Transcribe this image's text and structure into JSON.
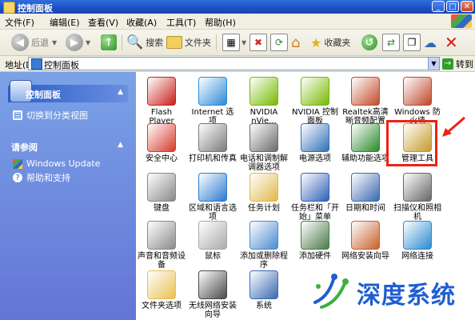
{
  "window": {
    "title": "控制面板"
  },
  "menu": [
    "文件(F)",
    "编辑(E)",
    "查看(V)",
    "收藏(A)",
    "工具(T)",
    "帮助(H)"
  ],
  "toolbar": {
    "back_label": "后退",
    "search_label": "搜索",
    "folders_label": "文件夹",
    "favorites_label": "收藏夹"
  },
  "address": {
    "label": "地址(D)",
    "value": "控制面板",
    "go_label": "转到"
  },
  "sidebar": {
    "panel1": {
      "title": "控制面板",
      "items": [
        {
          "label": "切换到分类视图",
          "icon": "category-view-icon"
        }
      ]
    },
    "panel2": {
      "title": "请参阅",
      "items": [
        {
          "label": "Windows Update",
          "icon": "windows-update-icon"
        },
        {
          "label": "帮助和支持",
          "icon": "help-icon"
        }
      ]
    }
  },
  "control_panel_items": [
    {
      "label": "Flash Player",
      "icon": "flash-icon",
      "color": "#c8201a"
    },
    {
      "label": "Internet 选项",
      "icon": "globe-icon",
      "color": "#2a8ad8"
    },
    {
      "label": "NVIDIA nVie...",
      "icon": "nvidia-icon",
      "color": "#76b900"
    },
    {
      "label": "NVIDIA 控制面板",
      "icon": "nvidia-panel-icon",
      "color": "#76b900"
    },
    {
      "label": "Realtek高清晰音频配置",
      "icon": "speaker-icon",
      "color": "#c24b2a"
    },
    {
      "label": "Windows 防火墙",
      "icon": "firewall-icon",
      "color": "#c0462a"
    },
    {
      "label": "安全中心",
      "icon": "shield-icon",
      "color": "#d43a2a"
    },
    {
      "label": "打印机和传真",
      "icon": "printer-icon",
      "color": "#7a7a7a"
    },
    {
      "label": "电话和调制解调器选项",
      "icon": "phone-icon",
      "color": "#6a6a6a"
    },
    {
      "label": "电源选项",
      "icon": "power-icon",
      "color": "#2f6fb8"
    },
    {
      "label": "辅助功能选项",
      "icon": "accessibility-icon",
      "color": "#2a8a2a"
    },
    {
      "label": "管理工具",
      "icon": "admin-tools-icon",
      "color": "#c49a2a"
    },
    {
      "label": "键盘",
      "icon": "keyboard-icon",
      "color": "#888888"
    },
    {
      "label": "区域和语言选项",
      "icon": "region-globe-icon",
      "color": "#2a7ad0"
    },
    {
      "label": "任务计划",
      "icon": "task-folder-icon",
      "color": "#e0b84a"
    },
    {
      "label": "任务栏和「开始」菜单",
      "icon": "taskbar-icon",
      "color": "#2f5fb8"
    },
    {
      "label": "日期和时间",
      "icon": "clock-icon",
      "color": "#3a6ab0"
    },
    {
      "label": "扫描仪和照相机",
      "icon": "scanner-icon",
      "color": "#666666"
    },
    {
      "label": "声音和音频设备",
      "icon": "sound-icon",
      "color": "#8a8a8a"
    },
    {
      "label": "鼠标",
      "icon": "mouse-icon",
      "color": "#aaaaaa"
    },
    {
      "label": "添加或删除程序",
      "icon": "add-remove-icon",
      "color": "#4a8ad0"
    },
    {
      "label": "添加硬件",
      "icon": "hardware-icon",
      "color": "#4a7a4a"
    },
    {
      "label": "网络安装向导",
      "icon": "network-setup-icon",
      "color": "#c8602a"
    },
    {
      "label": "网络连接",
      "icon": "network-icon",
      "color": "#2a8ad0"
    },
    {
      "label": "文件夹选项",
      "icon": "folder-options-icon",
      "color": "#e8c050"
    },
    {
      "label": "无线网络安装向导",
      "icon": "wireless-icon",
      "color": "#4a4a4a"
    },
    {
      "label": "系统",
      "icon": "computer-icon",
      "color": "#3a6ab0"
    }
  ],
  "watermark": {
    "text": "深度系统"
  },
  "colors": {
    "highlight": "#e21111",
    "sidebar": "#7ba2e7",
    "titlebar": "#1a4fc4"
  }
}
